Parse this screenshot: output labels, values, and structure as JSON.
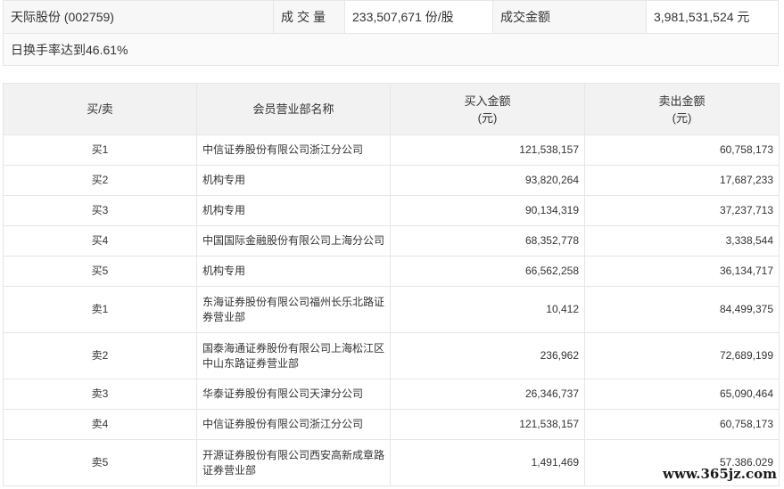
{
  "summary": {
    "stock_name": "天际股份 (002759)",
    "volume_label": "成交量",
    "volume_value": "233,507,671 份/股",
    "amount_label": "成交金额",
    "amount_value": "3,981,531,524 元",
    "turnover_note": "日换手率达到46.61%"
  },
  "table": {
    "headers": {
      "side": "买/卖",
      "branch": "会员营业部名称",
      "buy_line1": "买入金额",
      "buy_line2": "(元)",
      "sell_line1": "卖出金额",
      "sell_line2": "(元)"
    },
    "rows": [
      {
        "side": "买1",
        "branch": "中信证券股份有限公司浙江分公司",
        "buy": "121,538,157",
        "sell": "60,758,173"
      },
      {
        "side": "买2",
        "branch": "机构专用",
        "buy": "93,820,264",
        "sell": "17,687,233"
      },
      {
        "side": "买3",
        "branch": "机构专用",
        "buy": "90,134,319",
        "sell": "37,237,713"
      },
      {
        "side": "买4",
        "branch": "中国国际金融股份有限公司上海分公司",
        "buy": "68,352,778",
        "sell": "3,338,544"
      },
      {
        "side": "买5",
        "branch": "机构专用",
        "buy": "66,562,258",
        "sell": "36,134,717"
      },
      {
        "side": "卖1",
        "branch": "东海证券股份有限公司福州长乐北路证券营业部",
        "buy": "10,412",
        "sell": "84,499,375"
      },
      {
        "side": "卖2",
        "branch": "国泰海通证券股份有限公司上海松江区中山东路证券营业部",
        "buy": "236,962",
        "sell": "72,689,199"
      },
      {
        "side": "卖3",
        "branch": "华泰证券股份有限公司天津分公司",
        "buy": "26,346,737",
        "sell": "65,090,464"
      },
      {
        "side": "卖4",
        "branch": "中信证券股份有限公司浙江分公司",
        "buy": "121,538,157",
        "sell": "60,758,173"
      },
      {
        "side": "卖5",
        "branch": "开源证券股份有限公司西安高新成章路证券营业部",
        "buy": "1,491,469",
        "sell": "57,386,029"
      }
    ]
  },
  "watermark": "www.365jz.com"
}
